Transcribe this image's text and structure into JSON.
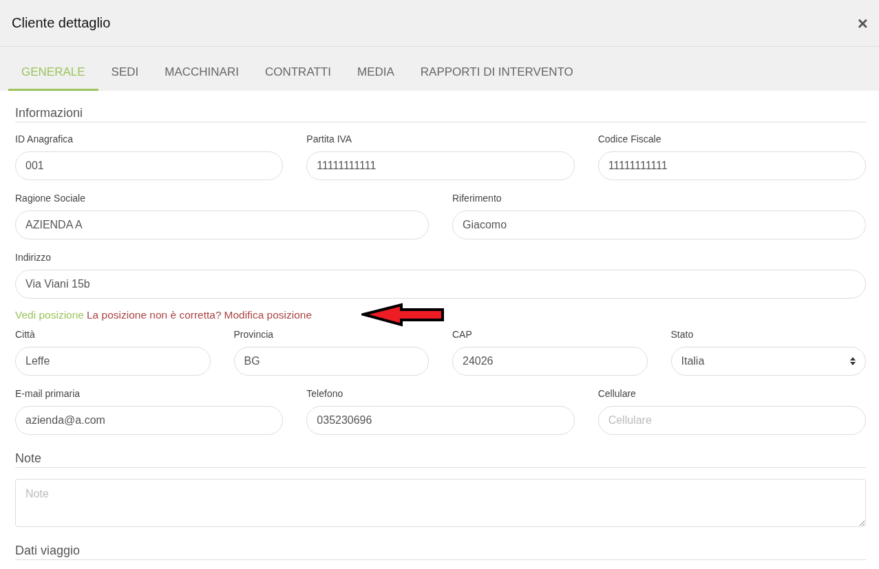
{
  "window": {
    "title": "Cliente dettaglio",
    "close": "×"
  },
  "tabs": [
    {
      "label": "GENERALE",
      "selected": true
    },
    {
      "label": "SEDI",
      "selected": false
    },
    {
      "label": "MACCHINARI",
      "selected": false
    },
    {
      "label": "CONTRATTI",
      "selected": false
    },
    {
      "label": "MEDIA",
      "selected": false
    },
    {
      "label": "RAPPORTI DI INTERVENTO",
      "selected": false
    }
  ],
  "sections": [
    {
      "title": "Informazioni",
      "rows": [
        {
          "fields": [
            {
              "kind": "input",
              "label": "ID Anagrafica",
              "value": "001"
            },
            {
              "kind": "input",
              "label": "Partita IVA",
              "value": "11111111111"
            },
            {
              "kind": "input",
              "label": "Codice Fiscale",
              "value": "11111111111"
            }
          ]
        },
        {
          "fields": [
            {
              "kind": "input",
              "label": "Ragione Sociale",
              "value": "AZIENDA A"
            },
            {
              "kind": "input",
              "label": "Riferimento",
              "value": "Giacomo"
            }
          ]
        },
        {
          "fields": [
            {
              "kind": "input",
              "label": "Indirizzo",
              "value": "Via Viani 15b"
            }
          ]
        },
        {
          "links": [
            {
              "kind": "link-green",
              "text": "Vedi posizione"
            },
            {
              "kind": "text",
              "text": "La posizione non è corretta?"
            },
            {
              "kind": "link-red",
              "text": "Modifica posizione"
            }
          ],
          "arrow": true
        },
        {
          "fields": [
            {
              "kind": "input",
              "label": "Città",
              "value": "Leffe"
            },
            {
              "kind": "input",
              "label": "Provincia",
              "value": "BG"
            },
            {
              "kind": "input",
              "label": "CAP",
              "value": "24026"
            },
            {
              "kind": "select",
              "label": "Stato",
              "value": "Italia"
            }
          ]
        },
        {
          "fields": [
            {
              "kind": "input",
              "label": "E-mail primaria",
              "value": "azienda@a.com"
            },
            {
              "kind": "input",
              "label": "Telefono",
              "value": "035230696"
            },
            {
              "kind": "input",
              "label": "Cellulare",
              "placeholder": "Cellulare"
            }
          ]
        }
      ]
    },
    {
      "title": "Note",
      "rows": [
        {
          "fields": [
            {
              "kind": "textarea",
              "placeholder": "Note"
            }
          ]
        }
      ]
    },
    {
      "title": "Dati viaggio"
    }
  ]
}
